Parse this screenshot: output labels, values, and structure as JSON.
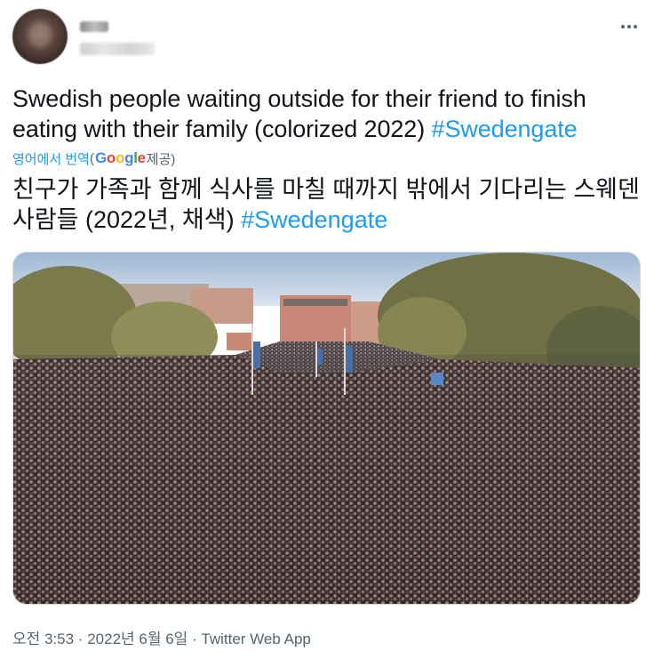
{
  "header": {
    "more_icon": "more-horizontal-icon"
  },
  "tweet": {
    "text": "Swedish people waiting outside for their friend to finish eating with their family (colorized 2022) ",
    "hashtag": "#Swedengate"
  },
  "translation": {
    "link_label": "영어에서 번역",
    "paren_open": "(",
    "google_logo_text": "Google",
    "provided_by": " 제공)",
    "text": "친구가 가족과 함께 식사를 마칠 때까지 밖에서 기다리는 스웨덴 사람들 (2022년, 채색) ",
    "hashtag": "#Swedengate"
  },
  "meta": {
    "time": "오전 3:53",
    "separator": " · ",
    "date": "2022년 6월 6일",
    "source": "Twitter Web App"
  },
  "colors": {
    "link": "#1d9bf0",
    "text": "#0f1419",
    "secondary": "#536471"
  }
}
